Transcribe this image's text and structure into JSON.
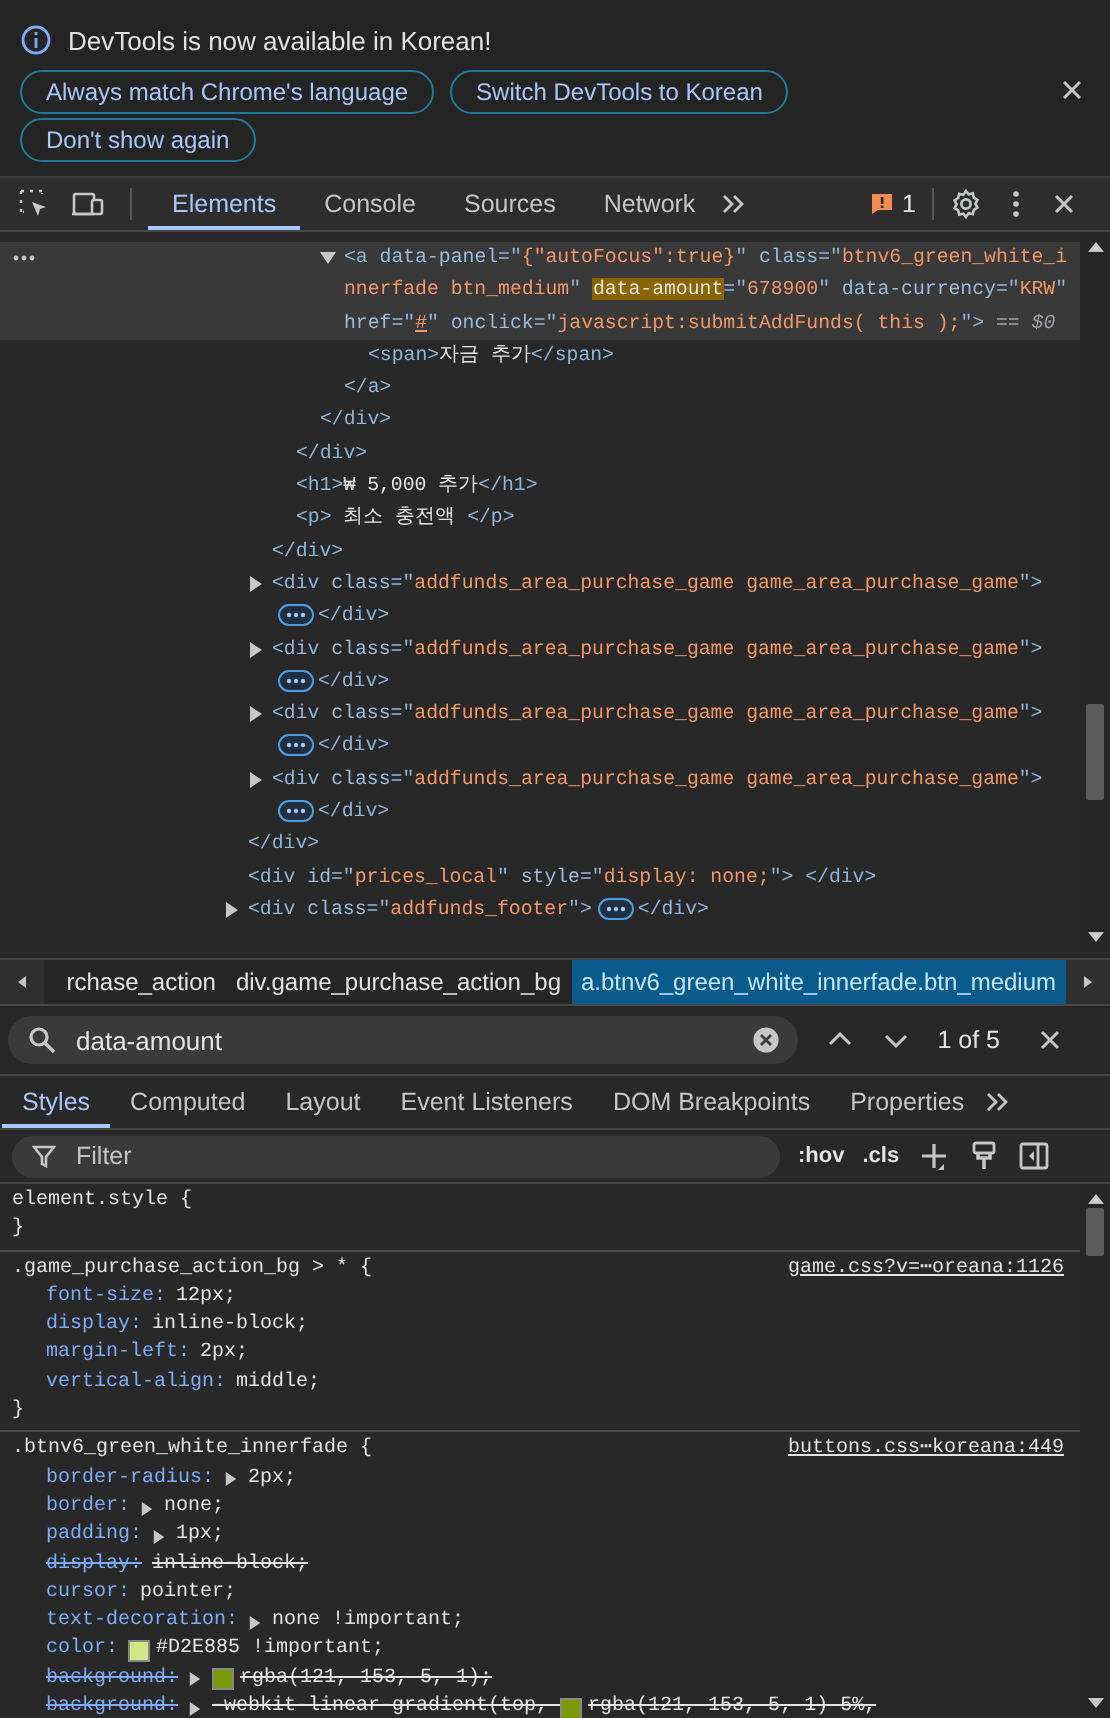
{
  "infobar": {
    "message": "DevTools is now available in Korean!",
    "buttons": [
      "Always match Chrome's language",
      "Switch DevTools to Korean",
      "Don't show again"
    ]
  },
  "toolbar": {
    "tabs": [
      {
        "label": "Elements",
        "selected": true
      },
      {
        "label": "Console",
        "selected": false
      },
      {
        "label": "Sources",
        "selected": false
      },
      {
        "label": "Network",
        "selected": false
      }
    ],
    "issues_count": "1"
  },
  "dom_tree": [
    {
      "children": [
        {
          "children": [
            {
              "children": [
                {
                  "children": [
                    {
                      "selected": true,
                      "expanded": true,
                      "open": [
                        {
                          "kind": "tag",
                          "text": "<a "
                        },
                        {
                          "kind": "attr",
                          "text": "data-panel"
                        },
                        {
                          "kind": "tag",
                          "text": "=\""
                        },
                        {
                          "kind": "value",
                          "text": "{\"autoFocus\":true}"
                        },
                        {
                          "kind": "tag",
                          "text": "\" "
                        },
                        {
                          "kind": "attr",
                          "text": "class"
                        },
                        {
                          "kind": "tag",
                          "text": "=\""
                        },
                        {
                          "kind": "value",
                          "text": "btnv6_green_white_innerfade btn_medium"
                        },
                        {
                          "kind": "tag",
                          "text": "\" "
                        },
                        {
                          "kind": "match",
                          "text": "data-amount"
                        },
                        {
                          "kind": "tag",
                          "text": "=\""
                        },
                        {
                          "kind": "value",
                          "text": "678900"
                        },
                        {
                          "kind": "tag",
                          "text": "\" "
                        },
                        {
                          "kind": "attr",
                          "text": "data-currency"
                        },
                        {
                          "kind": "tag",
                          "text": "=\""
                        },
                        {
                          "kind": "value",
                          "text": "KRW"
                        },
                        {
                          "kind": "tag",
                          "text": "\" "
                        },
                        {
                          "kind": "attr",
                          "text": "href"
                        },
                        {
                          "kind": "tag",
                          "text": "=\""
                        },
                        {
                          "kind": "link",
                          "text": "#"
                        },
                        {
                          "kind": "tag",
                          "text": "\" "
                        },
                        {
                          "kind": "attr",
                          "text": "onclick"
                        },
                        {
                          "kind": "tag",
                          "text": "=\""
                        },
                        {
                          "kind": "value",
                          "text": "javascript:submitAddFunds( this );"
                        },
                        {
                          "kind": "tag",
                          "text": "\">"
                        },
                        {
                          "kind": "dim",
                          "text": " == $0"
                        }
                      ],
                      "children": [
                        {
                          "selected": false,
                          "open": [
                            {
                              "kind": "tag",
                              "text": "<span>"
                            },
                            {
                              "kind": "text",
                              "text": "자금 추가"
                            },
                            {
                              "kind": "tag",
                              "text": "</span>"
                            }
                          ]
                        }
                      ],
                      "close": [
                        {
                          "kind": "tag",
                          "text": "</a>"
                        }
                      ]
                    }
                  ],
                  "close": [
                    {
                      "kind": "tag",
                      "text": "</div>"
                    }
                  ]
                }
              ],
              "close": [
                {
                  "kind": "tag",
                  "text": "</div>"
                }
              ]
            },
            {
              "selected": false,
              "open": [
                {
                  "kind": "tag",
                  "text": "<h1>"
                },
                {
                  "kind": "text",
                  "text": "₩ 5,000 추가"
                },
                {
                  "kind": "tag",
                  "text": "</h1>"
                }
              ]
            },
            {
              "selected": false,
              "open": [
                {
                  "kind": "tag",
                  "text": "<p>"
                },
                {
                  "kind": "text",
                  "text": " 최소 충전액 "
                },
                {
                  "kind": "tag",
                  "text": "</p>"
                }
              ]
            }
          ],
          "close": [
            {
              "kind": "tag",
              "text": "</div>"
            }
          ]
        },
        {
          "selected": false,
          "expanded": false,
          "open": [
            {
              "kind": "tag",
              "text": "<div "
            },
            {
              "kind": "attr",
              "text": "class"
            },
            {
              "kind": "tag",
              "text": "=\""
            },
            {
              "kind": "value",
              "text": "addfunds_area_purchase_game game_area_purchase_game"
            },
            {
              "kind": "tag",
              "text": "\">"
            }
          ],
          "close": [
            {
              "kind": "ellipsis"
            },
            {
              "kind": "tag",
              "text": "</div>"
            }
          ]
        },
        {
          "selected": false,
          "expanded": false,
          "open": [
            {
              "kind": "tag",
              "text": "<div "
            },
            {
              "kind": "attr",
              "text": "class"
            },
            {
              "kind": "tag",
              "text": "=\""
            },
            {
              "kind": "value",
              "text": "addfunds_area_purchase_game game_area_purchase_game"
            },
            {
              "kind": "tag",
              "text": "\">"
            }
          ],
          "close": [
            {
              "kind": "ellipsis"
            },
            {
              "kind": "tag",
              "text": "</div>"
            }
          ]
        },
        {
          "selected": false,
          "expanded": false,
          "open": [
            {
              "kind": "tag",
              "text": "<div "
            },
            {
              "kind": "attr",
              "text": "class"
            },
            {
              "kind": "tag",
              "text": "=\""
            },
            {
              "kind": "value",
              "text": "addfunds_area_purchase_game game_area_purchase_game"
            },
            {
              "kind": "tag",
              "text": "\">"
            }
          ],
          "close": [
            {
              "kind": "ellipsis"
            },
            {
              "kind": "tag",
              "text": "</div>"
            }
          ]
        },
        {
          "selected": false,
          "expanded": false,
          "open": [
            {
              "kind": "tag",
              "text": "<div "
            },
            {
              "kind": "attr",
              "text": "class"
            },
            {
              "kind": "tag",
              "text": "=\""
            },
            {
              "kind": "value",
              "text": "addfunds_area_purchase_game game_area_purchase_game"
            },
            {
              "kind": "tag",
              "text": "\">"
            }
          ],
          "close": [
            {
              "kind": "ellipsis"
            },
            {
              "kind": "tag",
              "text": "</div>"
            }
          ]
        }
      ],
      "close": [
        {
          "kind": "tag",
          "text": "</div>"
        }
      ]
    },
    {
      "selected": false,
      "open": [
        {
          "kind": "tag",
          "text": "<div "
        },
        {
          "kind": "attr",
          "text": "id"
        },
        {
          "kind": "tag",
          "text": "=\""
        },
        {
          "kind": "value",
          "text": "prices_local"
        },
        {
          "kind": "tag",
          "text": "\" "
        },
        {
          "kind": "attr",
          "text": "style"
        },
        {
          "kind": "tag",
          "text": "=\""
        },
        {
          "kind": "value",
          "text": "display: none;"
        },
        {
          "kind": "tag",
          "text": "\"> </div>"
        }
      ]
    },
    {
      "selected": false,
      "expanded": false,
      "open": [
        {
          "kind": "tag",
          "text": "<div "
        },
        {
          "kind": "attr",
          "text": "class"
        },
        {
          "kind": "tag",
          "text": "=\""
        },
        {
          "kind": "value",
          "text": "addfunds_footer"
        },
        {
          "kind": "tag",
          "text": "\">"
        }
      ],
      "close": [
        {
          "kind": "ellipsis"
        },
        {
          "kind": "tag",
          "text": "</div>"
        }
      ]
    }
  ],
  "breadcrumbs": [
    {
      "label": "rchase_action",
      "selected": false
    },
    {
      "label": "div.game_purchase_action_bg",
      "selected": false
    },
    {
      "label": "a.btnv6_green_white_innerfade.btn_medium",
      "selected": true
    }
  ],
  "search": {
    "value": "data-amount",
    "result": "1 of 5"
  },
  "sidebar_tabs": [
    {
      "label": "Styles",
      "selected": true
    },
    {
      "label": "Computed",
      "selected": false
    },
    {
      "label": "Layout",
      "selected": false
    },
    {
      "label": "Event Listeners",
      "selected": false
    },
    {
      "label": "DOM Breakpoints",
      "selected": false
    },
    {
      "label": "Properties",
      "selected": false
    }
  ],
  "filter": {
    "placeholder": "Filter",
    "buttons": [
      ":hov",
      ".cls"
    ]
  },
  "rules": [
    {
      "selector": "element.style",
      "open": "{",
      "close": "}"
    },
    {
      "selector": ".game_purchase_action_bg > *",
      "open": "{",
      "source": "game.css?v=⋯oreana:1126",
      "close": "}",
      "declarations": [
        {
          "name": "font-size:",
          "value": "12px;",
          "expandable": false,
          "overridden": false
        },
        {
          "name": "display:",
          "value": "inline-block;",
          "expandable": false,
          "overridden": false
        },
        {
          "name": "margin-left:",
          "value": "2px;",
          "expandable": false,
          "overridden": false
        },
        {
          "name": "vertical-align:",
          "value": "middle;",
          "expandable": false,
          "overridden": false
        }
      ]
    },
    {
      "selector": ".btnv6_green_white_innerfade",
      "open": "{",
      "source": "buttons.css⋯koreana:449",
      "declarations": [
        {
          "name": "border-radius:",
          "value": "2px;",
          "expandable": true,
          "overridden": false
        },
        {
          "name": "border:",
          "value": "none;",
          "expandable": true,
          "overridden": false
        },
        {
          "name": "padding:",
          "value": "1px;",
          "expandable": true,
          "overridden": false
        },
        {
          "name": "display:",
          "value": "inline-block;",
          "expandable": false,
          "overridden": true
        },
        {
          "name": "cursor:",
          "value": "pointer;",
          "expandable": false,
          "overridden": false
        },
        {
          "name": "text-decoration:",
          "value": "none !important;",
          "expandable": true,
          "overridden": false
        },
        {
          "name": "color:",
          "value_parts": [
            {
              "kind": "swatch",
              "color": "#d2e885"
            },
            {
              "kind": "text",
              "text": "#D2E885 !important;"
            }
          ],
          "expandable": false,
          "overridden": false
        },
        {
          "name": "background:",
          "value_parts": [
            {
              "kind": "swatch",
              "color": "#799905"
            },
            {
              "kind": "text",
              "text": "rgba(121, 153, 5, 1);"
            }
          ],
          "expandable": true,
          "overridden": true
        },
        {
          "name": "background:",
          "value_parts": [
            {
              "kind": "text",
              "text": "-webkit-linear-gradient(top, "
            },
            {
              "kind": "swatch",
              "color": "#799905"
            },
            {
              "kind": "text",
              "text": "rgba(121, 153, 5, 1) 5%,"
            }
          ],
          "expandable": true,
          "overridden": true
        }
      ]
    }
  ]
}
